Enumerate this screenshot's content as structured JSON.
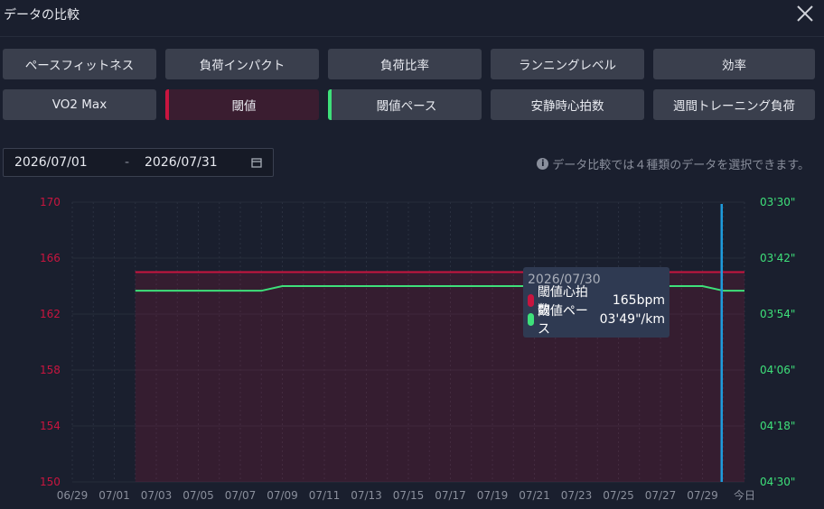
{
  "dialog": {
    "title": "データの比較"
  },
  "metrics": [
    {
      "label": "ペースフィットネス",
      "state": ""
    },
    {
      "label": "負荷インパクト",
      "state": ""
    },
    {
      "label": "負荷比率",
      "state": ""
    },
    {
      "label": "ランニングレベル",
      "state": ""
    },
    {
      "label": "効率",
      "state": ""
    },
    {
      "label": "VO2 Max",
      "state": ""
    },
    {
      "label": "閾値",
      "state": "selected-red"
    },
    {
      "label": "閾値ペース",
      "state": "selected-green"
    },
    {
      "label": "安静時心拍数",
      "state": ""
    },
    {
      "label": "週間トレーニング負荷",
      "state": ""
    }
  ],
  "date_range": {
    "start": "2026/07/01",
    "separator": "-",
    "end": "2026/07/31"
  },
  "hint": "データ比較では４種類のデータを選択できます。",
  "tooltip": {
    "date": "2026/07/30",
    "rows": [
      {
        "label": "閾値心拍数",
        "value": "165bpm",
        "color": "#c8153f"
      },
      {
        "label": "閾値ペース",
        "value": "03'49\"/km",
        "color": "#3ee07a"
      }
    ]
  },
  "colors": {
    "hr": "#c8153f",
    "pace": "#3ee07a",
    "cursor": "#1e9bdc"
  },
  "chart_data": {
    "type": "line",
    "x": [
      "06/29",
      "06/30",
      "07/01",
      "07/02",
      "07/03",
      "07/04",
      "07/05",
      "07/06",
      "07/07",
      "07/08",
      "07/09",
      "07/10",
      "07/11",
      "07/12",
      "07/13",
      "07/14",
      "07/15",
      "07/16",
      "07/17",
      "07/18",
      "07/19",
      "07/20",
      "07/21",
      "07/22",
      "07/23",
      "07/24",
      "07/25",
      "07/26",
      "07/27",
      "07/28",
      "07/29",
      "07/30",
      "今日"
    ],
    "x_tick_labels": [
      "06/29",
      "07/01",
      "07/03",
      "07/05",
      "07/07",
      "07/09",
      "07/11",
      "07/13",
      "07/15",
      "07/17",
      "07/19",
      "07/21",
      "07/23",
      "07/25",
      "07/27",
      "07/29",
      "今日"
    ],
    "series": [
      {
        "name": "閾値心拍数",
        "axis": "left",
        "color": "#c8153f",
        "filled": true,
        "start_index": 3,
        "values": [
          165,
          165,
          165,
          165,
          165,
          165,
          165,
          165,
          165,
          165,
          165,
          165,
          165,
          165,
          165,
          165,
          165,
          165,
          165,
          165,
          165,
          165,
          165,
          165,
          165,
          165,
          165,
          165,
          165,
          165
        ]
      },
      {
        "name": "閾値ペース",
        "axis": "right",
        "color": "#3ee07a",
        "filled": false,
        "start_index": 3,
        "values": [
          229,
          229,
          229,
          229,
          229,
          229,
          229,
          228,
          228,
          228,
          228,
          228,
          228,
          228,
          228,
          228,
          228,
          228,
          228,
          228,
          228,
          228,
          228,
          228,
          228,
          228,
          228,
          228,
          229,
          229
        ]
      }
    ],
    "y_left": {
      "min": 150,
      "max": 170,
      "ticks": [
        150,
        154,
        158,
        162,
        166,
        170
      ]
    },
    "y_right": {
      "ticks": [
        "04'30\"",
        "04'18\"",
        "04'06\"",
        "03'54\"",
        "03'42\"",
        "03'30\""
      ],
      "min_seconds": 270,
      "max_seconds": 210
    },
    "cursor_index": 31,
    "grid": true
  }
}
